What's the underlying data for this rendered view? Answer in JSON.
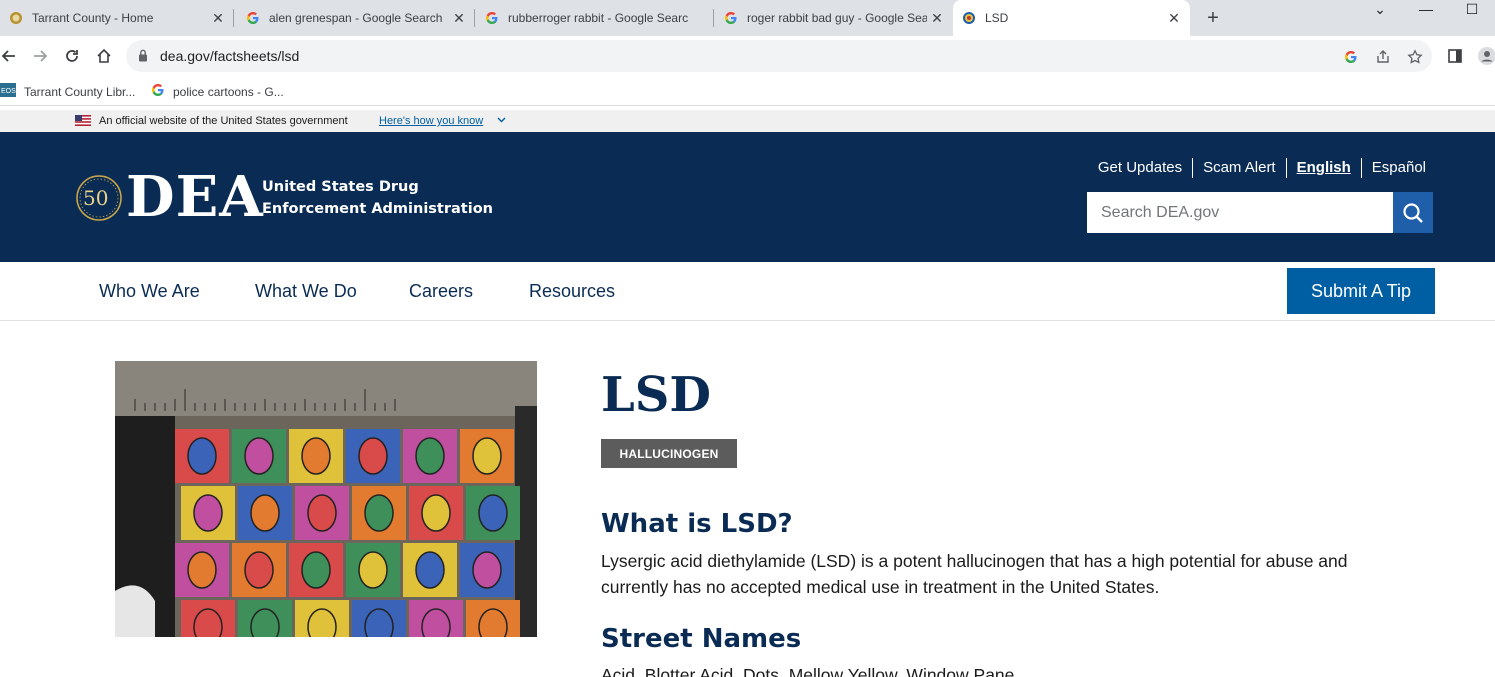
{
  "browser": {
    "tabs": [
      {
        "title": "Tarrant County - Home",
        "icon": "seal-favicon"
      },
      {
        "title": "alen grenespan - Google Search",
        "icon": "google-icon"
      },
      {
        "title": "rubberroger rabbit - Google Search",
        "icon": "google-icon"
      },
      {
        "title": "roger rabbit bad guy - Google Search",
        "icon": "google-icon"
      },
      {
        "title": "LSD",
        "icon": "dea-favicon",
        "active": true
      }
    ],
    "url": "dea.gov/factsheets/lsd",
    "bookmarks": [
      {
        "label": "Tarrant County Libr...",
        "icon": "library-favicon"
      },
      {
        "label": "police cartoons - G...",
        "icon": "google-icon"
      }
    ]
  },
  "gov_banner": {
    "text": "An official website of the United States government",
    "link": "Here's how you know"
  },
  "header": {
    "logo_text": "DEA",
    "seal_text": "50",
    "agency_name": "United States Drug Enforcement Administration",
    "top_links": [
      "Get Updates",
      "Scam Alert",
      "English",
      "Español"
    ],
    "active_language": "English",
    "search_placeholder": "Search DEA.gov"
  },
  "nav": {
    "items": [
      "Who We Are",
      "What We Do",
      "Careers",
      "Resources"
    ],
    "tip_button": "Submit A Tip"
  },
  "content": {
    "title": "LSD",
    "tag": "HALLUCINOGEN",
    "what_heading": "What is LSD?",
    "what_text": "Lysergic acid diethylamide (LSD) is a potent hallucinogen that has a high potential for abuse and currently has no accepted medical use in treatment in the United States.",
    "street_heading": "Street Names",
    "street_text": "Acid, Blotter Acid, Dots, Mellow Yellow, Window Pane"
  },
  "colors": {
    "header_bg": "#0a2c54",
    "primary_blue": "#005ea2",
    "tag_gray": "#5c5c5c"
  }
}
